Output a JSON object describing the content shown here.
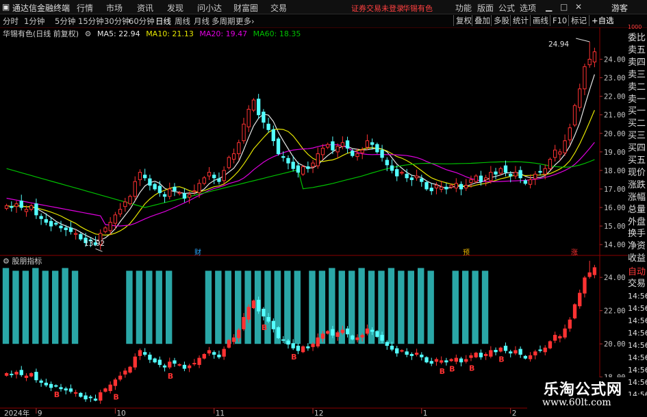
{
  "app": {
    "title": "通达信金融终端",
    "menu": [
      "行情",
      "市场",
      "资讯",
      "发现",
      "问小达",
      "财富圈",
      "交易"
    ],
    "status": "证券交易未登录",
    "stock_name": "华锡有色",
    "right_menu": [
      "功能",
      "版面",
      "公式",
      "选项"
    ],
    "window_controls": [
      "▁",
      "□",
      "✕"
    ],
    "guest": "游客"
  },
  "periods": {
    "items": [
      "分时",
      "1分钟",
      "5分钟",
      "15分钟",
      "30分钟",
      "60分钟",
      "日线",
      "周线",
      "月线",
      "多周期",
      "更多›"
    ],
    "active": "日线"
  },
  "toolbar": [
    "复权",
    "叠加",
    "多股",
    "统计",
    "画线",
    "F10",
    "标记",
    "+自选"
  ],
  "main_chart": {
    "title": "华锡有色(日线 前复权)",
    "ma": [
      {
        "label": "MA5: 22.94",
        "color": "#e8e8e8"
      },
      {
        "label": "MA10: 21.13",
        "color": "#e6e600"
      },
      {
        "label": "MA20: 19.47",
        "color": "#e000e0"
      },
      {
        "label": "MA60: 18.35",
        "color": "#00c000"
      }
    ],
    "high_label": "24.94",
    "low_label": "13.92",
    "markers": [
      "财",
      "预",
      "涨"
    ]
  },
  "sub_chart": {
    "title": "股朋指标",
    "b_label": "B"
  },
  "date_axis": [
    "2024年",
    "9",
    "10",
    "11",
    "12",
    "1",
    "2"
  ],
  "right_panel": {
    "header": "1000",
    "quote_labels": [
      "委比",
      "卖五",
      "卖四",
      "卖三",
      "卖二",
      "卖一",
      "买一",
      "买二",
      "买三",
      "买四",
      "买五",
      "现价",
      "涨跌",
      "涨幅",
      "总量",
      "外盘",
      "换手",
      "净资",
      "收益"
    ],
    "trade_labels": [
      "自动",
      "交易"
    ],
    "times": [
      "14:56",
      "14:56",
      "14:56",
      "14:56",
      "14:56",
      "14:56",
      "14:56",
      "14:56",
      "14:56",
      "14:56"
    ]
  },
  "watermark": {
    "title": "乐淘公式网",
    "url": "www.60lt.com"
  },
  "colors": {
    "up": "#ff3232",
    "down": "#54ffff",
    "bar": "#2aa7a7",
    "grid": "#8b0000"
  },
  "chart_data": [
    {
      "type": "candlestick",
      "title": "华锡有色(日线 前复权)",
      "y_ticks": [
        14.0,
        15.0,
        16.0,
        17.0,
        18.0,
        19.0,
        20.0,
        21.0,
        22.0,
        23.0,
        24.0
      ],
      "x_ticks": [
        "2024年",
        "9",
        "10",
        "11",
        "12",
        "1",
        "2"
      ],
      "close": [
        16.1,
        16.0,
        16.2,
        16.0,
        15.9,
        16.1,
        15.6,
        15.4,
        15.2,
        15.0,
        15.1,
        14.9,
        14.8,
        14.7,
        14.6,
        14.3,
        14.1,
        14.2,
        14.0,
        14.6,
        14.9,
        15.2,
        15.6,
        15.9,
        16.3,
        16.6,
        17.4,
        17.9,
        17.6,
        17.2,
        17.0,
        16.8,
        16.6,
        17.0,
        16.9,
        16.8,
        16.5,
        16.7,
        16.9,
        17.3,
        17.6,
        17.9,
        17.6,
        17.4,
        18.0,
        18.7,
        18.9,
        19.5,
        20.5,
        21.3,
        21.8,
        21.0,
        20.6,
        20.2,
        19.6,
        18.9,
        18.7,
        18.4,
        18.1,
        17.9,
        18.2,
        18.1,
        18.4,
        18.9,
        19.2,
        19.4,
        19.1,
        19.3,
        19.5,
        19.2,
        18.8,
        18.9,
        19.1,
        19.6,
        19.4,
        19.0,
        18.7,
        18.3,
        18.0,
        17.7,
        17.9,
        17.6,
        17.5,
        17.7,
        17.4,
        17.0,
        16.9,
        17.2,
        17.1,
        17.0,
        17.2,
        17.3,
        17.0,
        17.2,
        17.5,
        17.7,
        17.4,
        17.6,
        17.9,
        17.8,
        18.1,
        17.9,
        17.7,
        17.9,
        17.6,
        17.3,
        17.5,
        17.8,
        17.9,
        18.1,
        18.6,
        19.1,
        19.0,
        19.6,
        20.3,
        21.5,
        22.4,
        23.6,
        24.0,
        24.4
      ],
      "ma": {
        "MA5": 22.94,
        "MA10": 21.13,
        "MA20": 19.47,
        "MA60": 18.35
      },
      "high": 24.94,
      "low": 13.92
    },
    {
      "type": "bar",
      "title": "股朋指标",
      "y_ticks": [
        18.0,
        20.0,
        22.0,
        24.0
      ],
      "bar_groups": [
        [
          0,
          15
        ],
        [
          25,
          33
        ],
        [
          41,
          56
        ],
        [
          55,
          60
        ],
        [
          62,
          86
        ],
        [
          91,
          98
        ]
      ]
    }
  ]
}
